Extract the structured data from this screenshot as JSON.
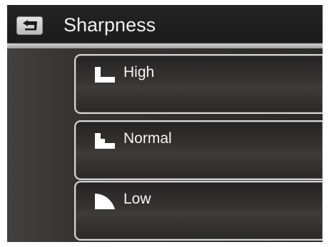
{
  "header": {
    "title": "Sharpness",
    "back_icon": "back-arrow-icon"
  },
  "options": [
    {
      "label": "High",
      "icon": "sharpness-high-icon"
    },
    {
      "label": "Normal",
      "icon": "sharpness-normal-icon"
    },
    {
      "label": "Low",
      "icon": "sharpness-low-icon"
    }
  ],
  "colors": {
    "background": "#2a2827",
    "text": "#f4f4f4",
    "border": "#d8d8d8"
  }
}
